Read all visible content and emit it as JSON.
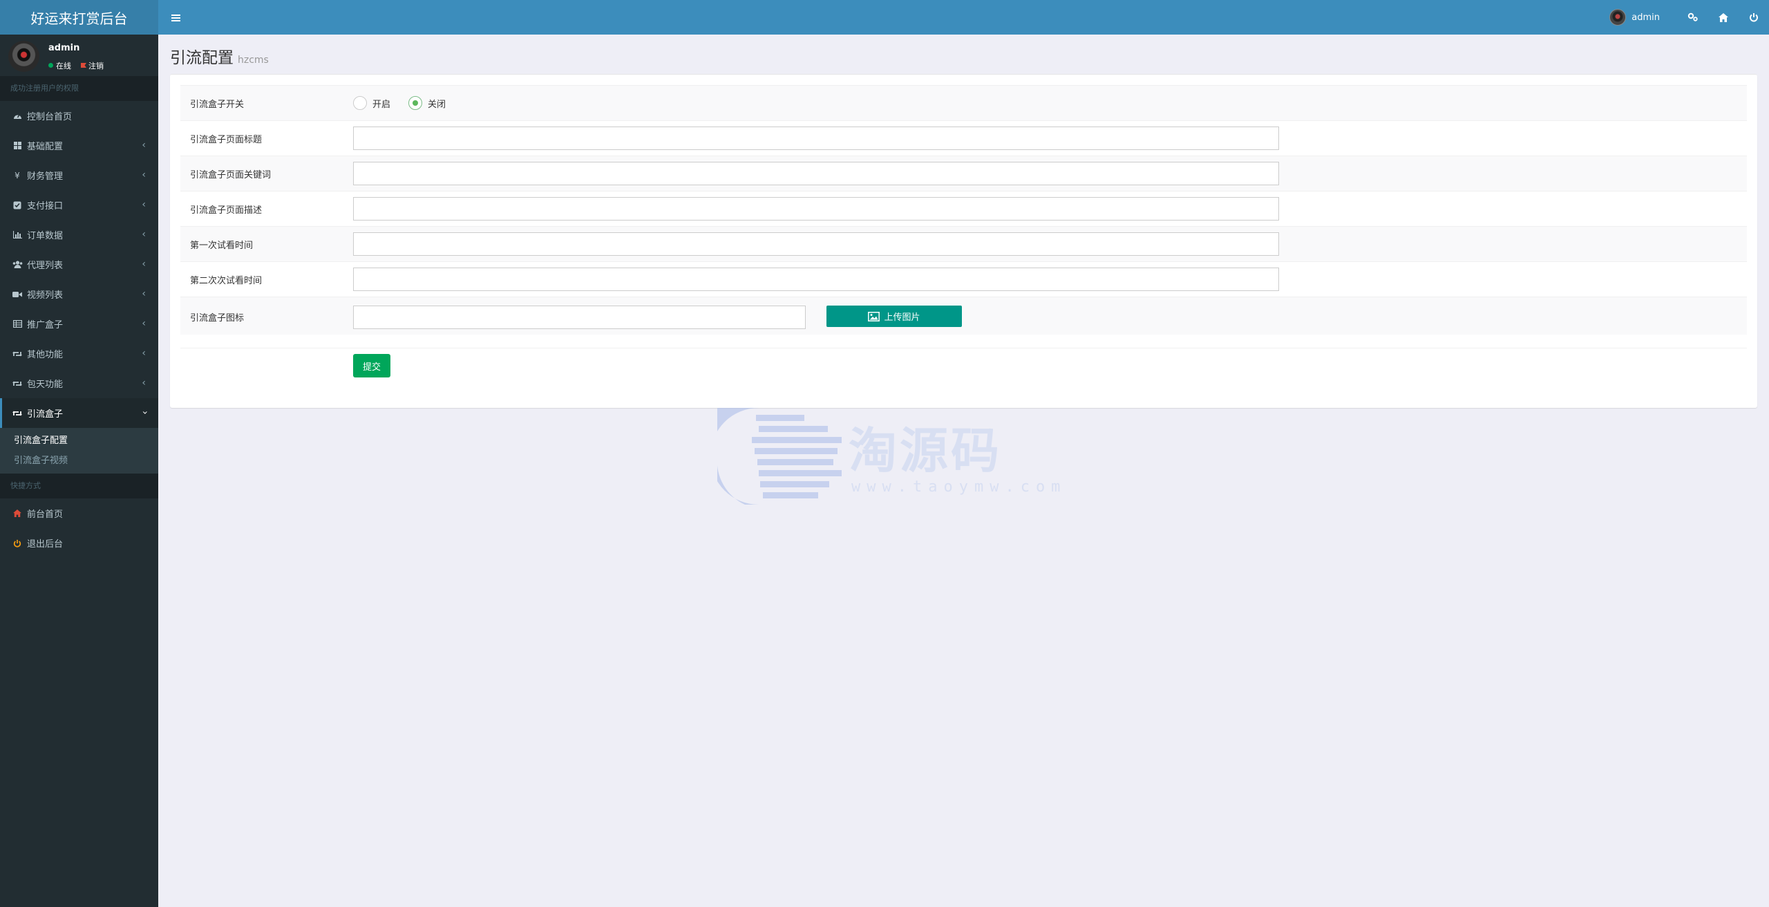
{
  "app": {
    "title": "好运来打赏后台"
  },
  "header": {
    "user_name": "admin",
    "icons": [
      "settings-icon",
      "home-icon",
      "power-icon"
    ]
  },
  "sidebar": {
    "user": {
      "name": "admin",
      "status_online": "在线",
      "status_logout": "注销"
    },
    "section_title": "成功注册用户的权限",
    "items": [
      {
        "label": "控制台首页",
        "icon": "dashboard-icon",
        "has_children": false
      },
      {
        "label": "基础配置",
        "icon": "grid-icon",
        "has_children": true
      },
      {
        "label": "财务管理",
        "icon": "yen-icon",
        "has_children": true
      },
      {
        "label": "支付接口",
        "icon": "checkbox-icon",
        "has_children": true
      },
      {
        "label": "订单数据",
        "icon": "bar-chart-icon",
        "has_children": true
      },
      {
        "label": "代理列表",
        "icon": "users-icon",
        "has_children": true
      },
      {
        "label": "视频列表",
        "icon": "video-icon",
        "has_children": true
      },
      {
        "label": "推广盒子",
        "icon": "table-icon",
        "has_children": true
      },
      {
        "label": "其他功能",
        "icon": "retweet-icon",
        "has_children": true
      },
      {
        "label": "包天功能",
        "icon": "retweet-icon",
        "has_children": true
      },
      {
        "label": "引流盒子",
        "icon": "retweet-icon",
        "has_children": true,
        "expanded": true
      }
    ],
    "submenu": [
      "引流盒子配置",
      "引流盒子视频"
    ],
    "shortcut_title": "快捷方式",
    "shortcuts": [
      {
        "label": "前台首页",
        "icon": "home-icon",
        "color": "#dd4b39"
      },
      {
        "label": "退出后台",
        "icon": "power-icon",
        "color": "#f39c12"
      }
    ]
  },
  "page": {
    "title": "引流配置",
    "subtitle": "hzcms"
  },
  "form": {
    "switch_label": "引流盒子开关",
    "switch_options": [
      "开启",
      "关闭"
    ],
    "switch_selected": "关闭",
    "fields": [
      {
        "label": "引流盒子页面标题",
        "value": ""
      },
      {
        "label": "引流盒子页面关键词",
        "value": ""
      },
      {
        "label": "引流盒子页面描述",
        "value": ""
      },
      {
        "label": "第一次试看时间",
        "value": ""
      },
      {
        "label": "第二次次试看时间",
        "value": ""
      }
    ],
    "icon_label": "引流盒子图标",
    "icon_value": "",
    "upload_button": "上传图片",
    "submit_button": "提交"
  },
  "watermark": {
    "text": "淘源码",
    "url": "www.taoymw.com"
  },
  "colors": {
    "header": "#3c8dbc",
    "sidebar": "#222d32",
    "upload": "#009688",
    "submit": "#00a65a"
  }
}
